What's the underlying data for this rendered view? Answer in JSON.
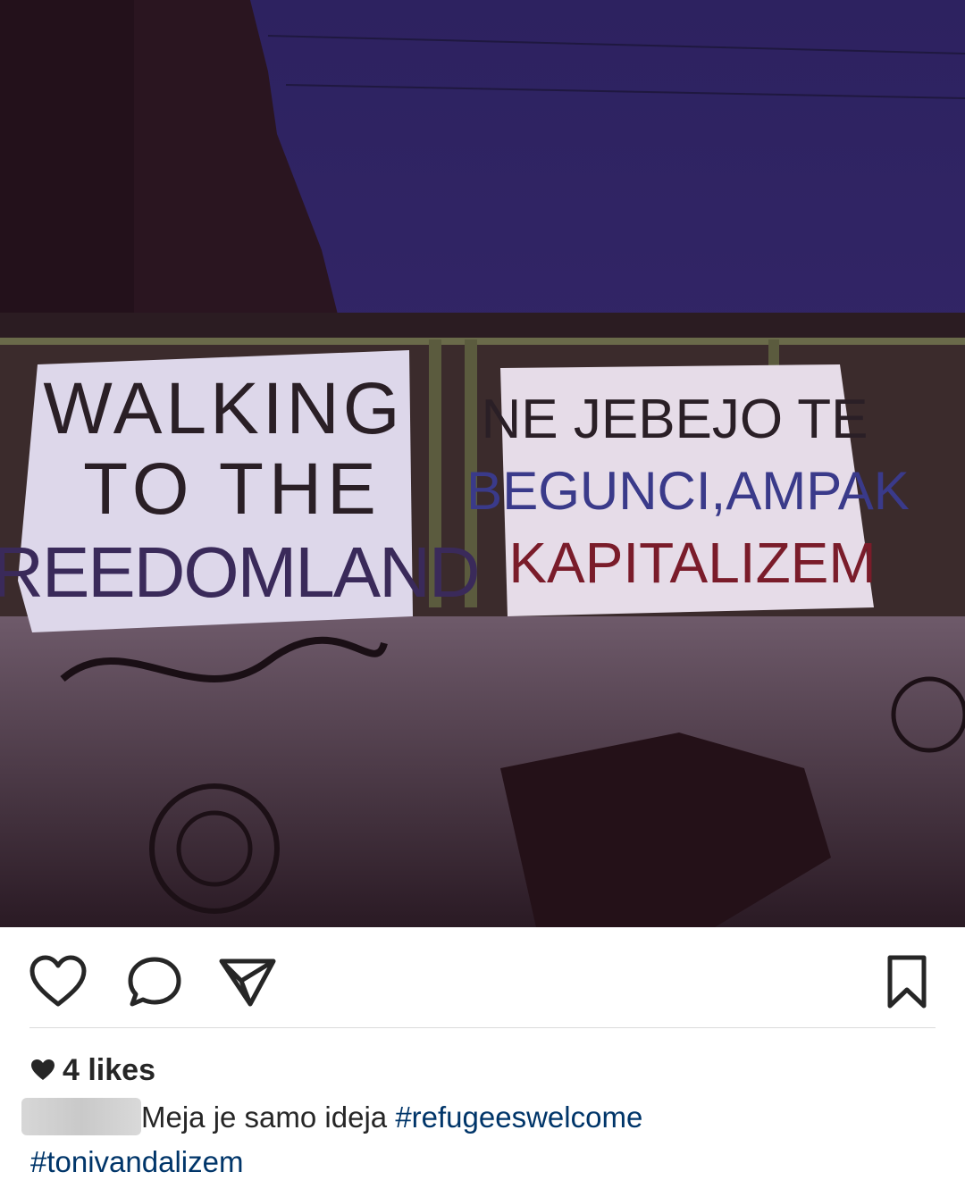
{
  "post": {
    "photo_label": "Photo of banners hung on a railing over a graffiti wall at night",
    "banner_left": [
      "WALKING",
      "TO THE",
      "FREEDOMLAND"
    ],
    "banner_right": [
      "NE JEBEJO TE",
      "BEGUNCI,AMPAK",
      "KAPITALIZEM"
    ]
  },
  "actions": {
    "like_icon": "heart-outline-icon",
    "comment_icon": "speech-bubble-icon",
    "share_icon": "paper-plane-icon",
    "save_icon": "bookmark-icon"
  },
  "likes": {
    "icon": "heart-filled-icon",
    "text": "4 likes"
  },
  "caption": {
    "text": "Meja je samo ideja ",
    "hashtags": [
      "#refugeeswelcome",
      "#tonivandalizem"
    ]
  },
  "colors": {
    "hashtag": "#003569",
    "text": "#262626",
    "divider": "#dbdbdb"
  }
}
